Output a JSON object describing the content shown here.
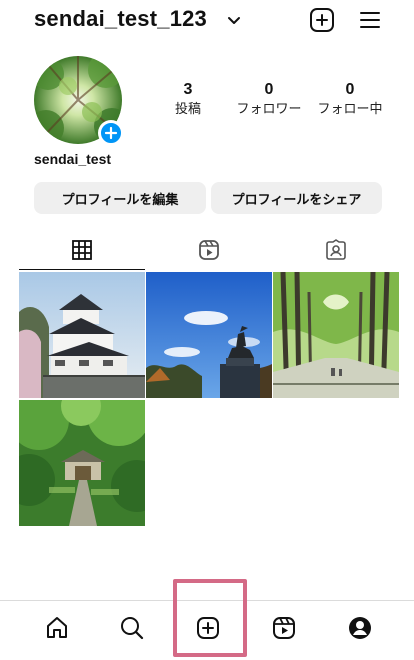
{
  "header": {
    "username": "sendai_test_123",
    "icons": [
      "chevron-down-icon",
      "plus-square-icon",
      "hamburger-menu-icon"
    ]
  },
  "profile": {
    "name": "sendai_test",
    "stats": {
      "posts": {
        "value": "3",
        "label": "投稿"
      },
      "followers": {
        "value": "0",
        "label": "フォロワー"
      },
      "following": {
        "value": "0",
        "label": "フォロー中"
      }
    }
  },
  "buttons": {
    "edit_profile": "プロフィールを編集",
    "share_profile": "プロフィールをシェア"
  },
  "tabs": [
    "grid-icon",
    "reels-icon",
    "tagged-icon"
  ],
  "posts": [
    "sendai-castle-tower",
    "date-masamune-statue",
    "zelkova-tree-avenue",
    "temple-in-forest"
  ],
  "bottom_nav": [
    "home-icon",
    "search-icon",
    "create-post-icon",
    "reels-icon",
    "profile-icon"
  ],
  "colors": {
    "accent_blue": "#0095f6",
    "highlight": "#d46a86",
    "button_bg": "#efefef"
  }
}
